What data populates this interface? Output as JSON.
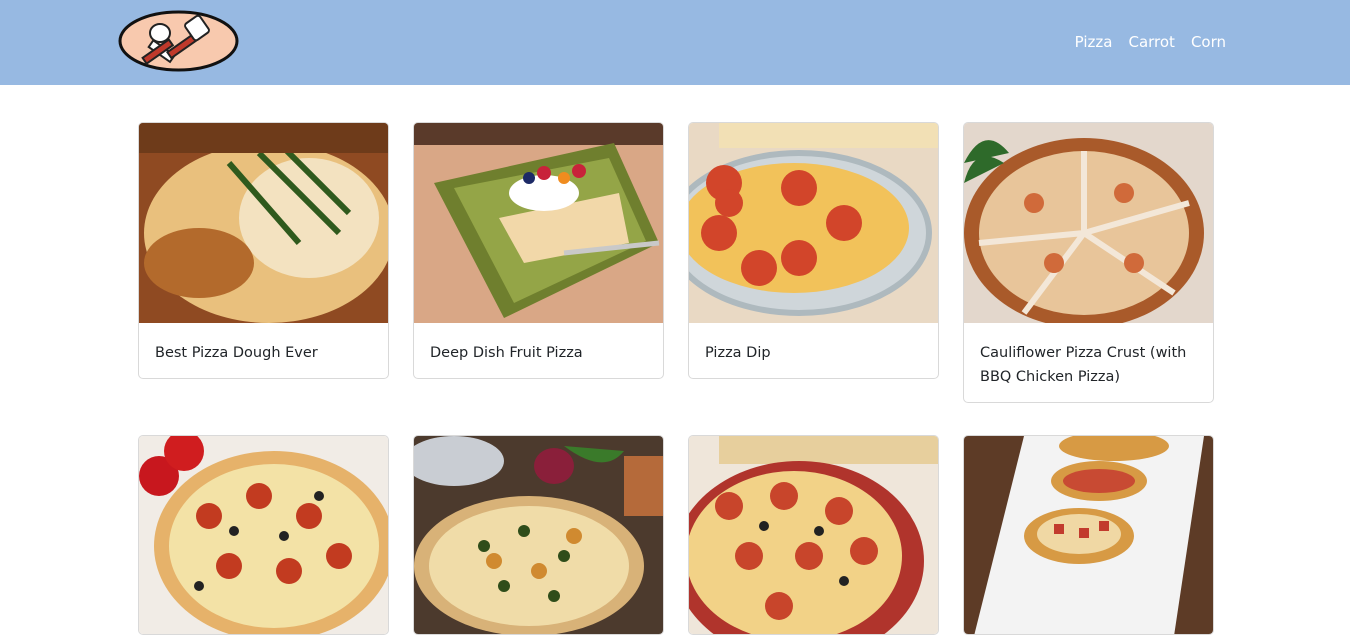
{
  "nav": {
    "logo_icon": "fork-spoon-logo-icon",
    "links": [
      "Pizza",
      "Carrot",
      "Corn"
    ]
  },
  "cards": [
    {
      "title": "Best Pizza Dough Ever",
      "image": "pizza-slice-basil-photo"
    },
    {
      "title": "Deep Dish Fruit Pizza",
      "image": "fruit-pizza-plate-photo"
    },
    {
      "title": "Pizza Dip",
      "image": "pepperoni-dip-dish-photo"
    },
    {
      "title": "Cauliflower Pizza Crust (with BBQ Chicken Pizza)",
      "image": "cauliflower-bbq-pizza-photo"
    },
    {
      "title": "",
      "image": "pepperoni-olive-pizza-photo"
    },
    {
      "title": "",
      "image": "herb-veggie-pizza-photo"
    },
    {
      "title": "",
      "image": "skillet-pepperoni-pizza-photo"
    },
    {
      "title": "",
      "image": "pizza-boats-platter-photo"
    }
  ],
  "colors": {
    "navbar": "#97b9e2",
    "nav_text": "#ffffff"
  }
}
